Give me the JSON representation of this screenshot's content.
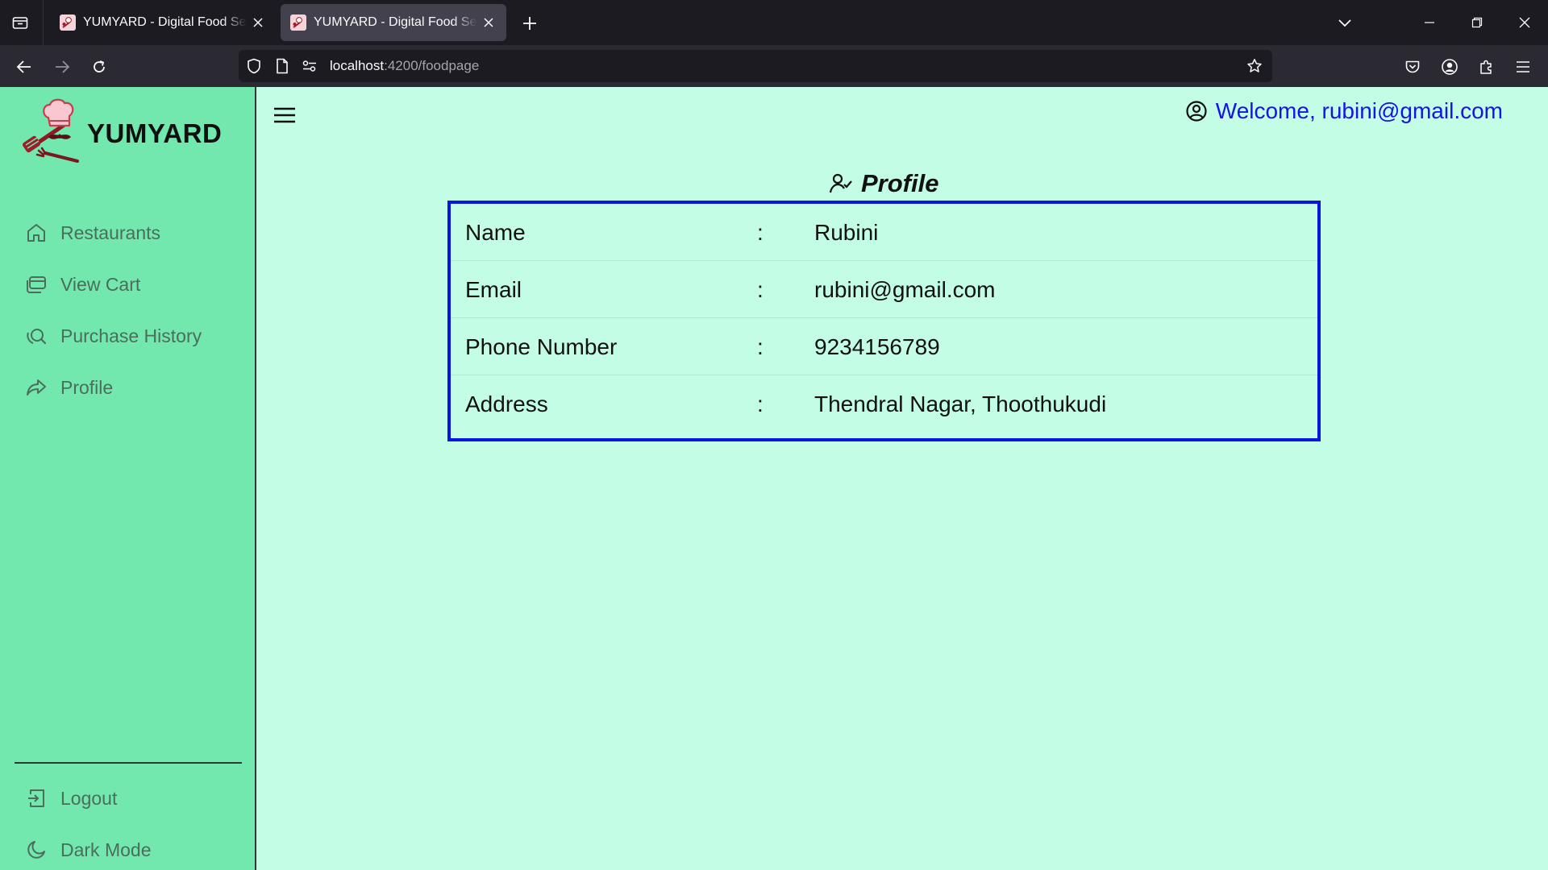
{
  "browser": {
    "tabs": [
      {
        "title": "YUMYARD - Digital Food Service"
      },
      {
        "title": "YUMYARD - Digital Food Service"
      }
    ],
    "url": {
      "host": "localhost",
      "path": ":4200/foodpage"
    }
  },
  "app": {
    "brand": "YUMYARD",
    "welcome": "Welcome, rubini@gmail.com",
    "sidebar": {
      "items": [
        {
          "label": "Restaurants",
          "icon": "home-icon"
        },
        {
          "label": "View Cart",
          "icon": "cart-icon"
        },
        {
          "label": "Purchase History",
          "icon": "history-search-icon"
        },
        {
          "label": "Profile",
          "icon": "share-arrow-icon"
        }
      ],
      "bottom_items": [
        {
          "label": "Logout",
          "icon": "logout-icon"
        },
        {
          "label": "Dark Mode",
          "icon": "moon-icon"
        }
      ]
    },
    "profile": {
      "heading": "Profile",
      "rows": [
        {
          "label": "Name",
          "sep": ":",
          "value": "Rubini"
        },
        {
          "label": "Email",
          "sep": ":",
          "value": "rubini@gmail.com"
        },
        {
          "label": "Phone Number",
          "sep": ":",
          "value": "9234156789"
        },
        {
          "label": "Address",
          "sep": ":",
          "value": "Thendral Nagar, Thoothukudi"
        }
      ]
    }
  },
  "colors": {
    "sidebar_bg": "#73e8ae",
    "content_bg": "#c3fde6",
    "welcome_text": "#1414e6",
    "card_border": "#0a14e0",
    "sidebar_text": "#4a6d5c"
  }
}
